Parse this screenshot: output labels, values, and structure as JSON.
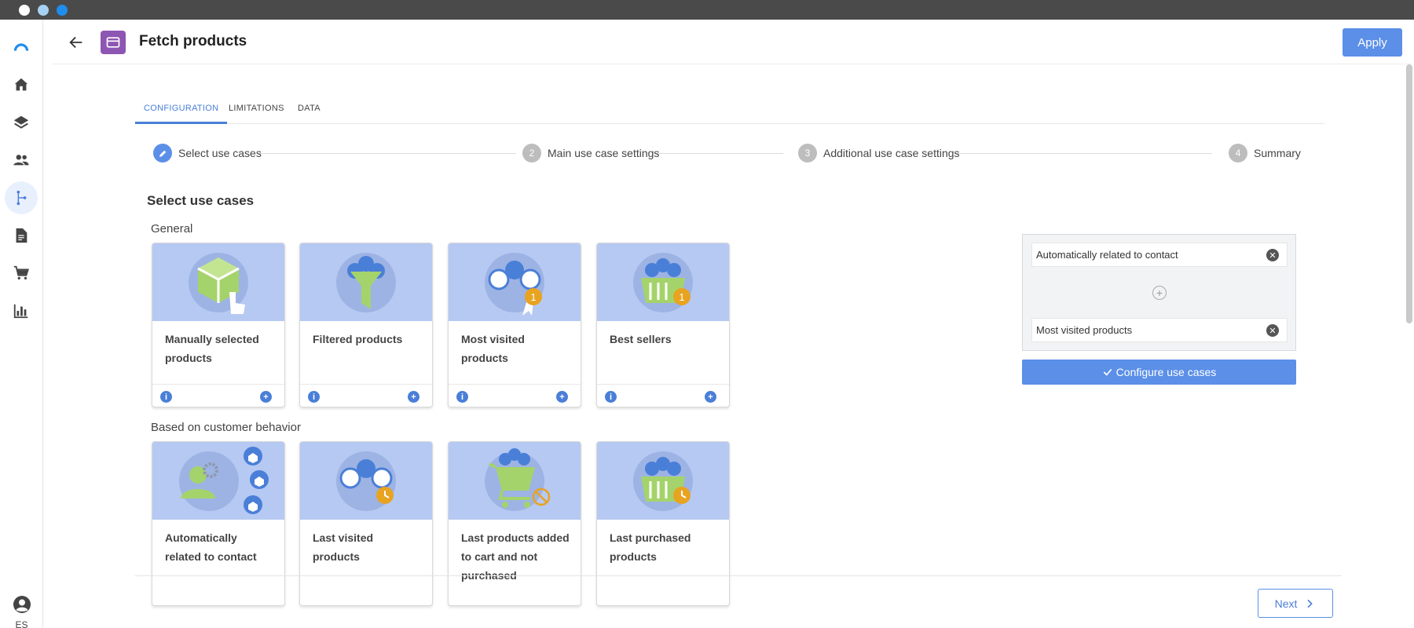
{
  "window": {
    "dots": [
      "#ffffff",
      "#a7d1f2",
      "#1f8ded"
    ]
  },
  "header": {
    "title": "Fetch products",
    "apply_label": "Apply",
    "accent": "#8e56b3"
  },
  "tabs": [
    {
      "label": "CONFIGURATION",
      "active": true
    },
    {
      "label": "LIMITATIONS",
      "active": false
    },
    {
      "label": "DATA",
      "active": false
    }
  ],
  "stepper": [
    {
      "number": "",
      "label": "Select use cases",
      "active": true
    },
    {
      "number": "2",
      "label": "Main use case settings",
      "active": false
    },
    {
      "number": "3",
      "label": "Additional use case settings",
      "active": false
    },
    {
      "number": "4",
      "label": "Summary",
      "active": false
    }
  ],
  "section_title": "Select use cases",
  "groups": [
    {
      "title": "General",
      "cards": [
        {
          "label": "Manually selected products",
          "icon": "cube-pointer-icon"
        },
        {
          "label": "Filtered products",
          "icon": "funnel-cubes-icon"
        },
        {
          "label": "Most visited products",
          "icon": "cubes-medal-icon"
        },
        {
          "label": "Best sellers",
          "icon": "basket-medal-icon"
        }
      ]
    },
    {
      "title": "Based on customer behavior",
      "cards": [
        {
          "label": "Automatically related to contact",
          "icon": "person-gears-icon"
        },
        {
          "label": "Last visited products",
          "icon": "cubes-clock-icon"
        },
        {
          "label": "Last products added to cart and not purchased",
          "icon": "cart-blocked-icon"
        },
        {
          "label": "Last purchased products",
          "icon": "basket-clock-icon"
        }
      ]
    }
  ],
  "selection": {
    "items": [
      "Automatically related to contact",
      "Most visited products"
    ],
    "configure_label": "Configure use cases"
  },
  "footer": {
    "next_label": "Next"
  },
  "user": {
    "initials": "ES"
  },
  "colors": {
    "primary": "#5b8fe8",
    "card_bg": "#b6c9f2",
    "medal": "#e8a320"
  }
}
